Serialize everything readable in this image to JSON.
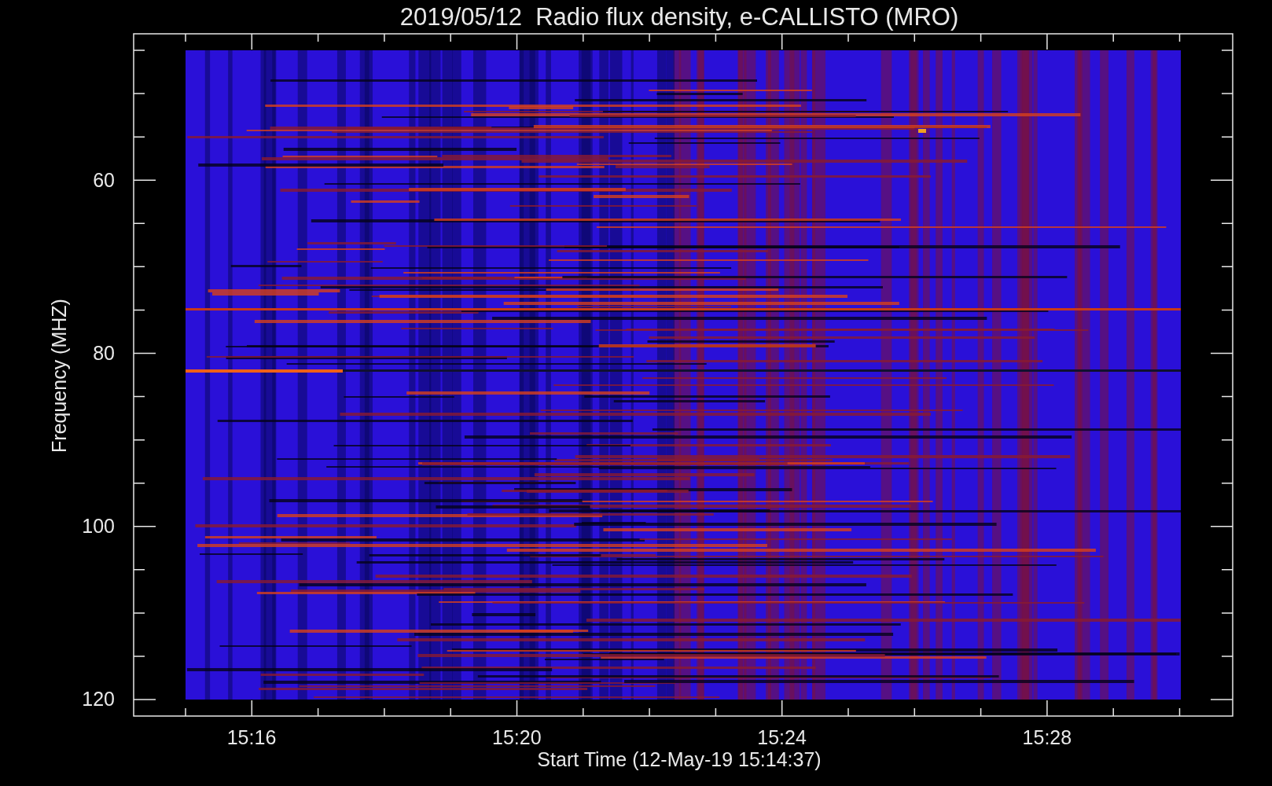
{
  "title": "2019/05/12  Radio flux density, e-CALLISTO (MRO)",
  "y_axis": {
    "label": "Frequency (MHZ)",
    "ticks": [
      "60",
      "80",
      "100",
      "120"
    ]
  },
  "x_axis": {
    "label": "Start Time (12-May-19 15:14:37)",
    "ticks": [
      "15:16",
      "15:20",
      "15:24",
      "15:28"
    ]
  }
}
